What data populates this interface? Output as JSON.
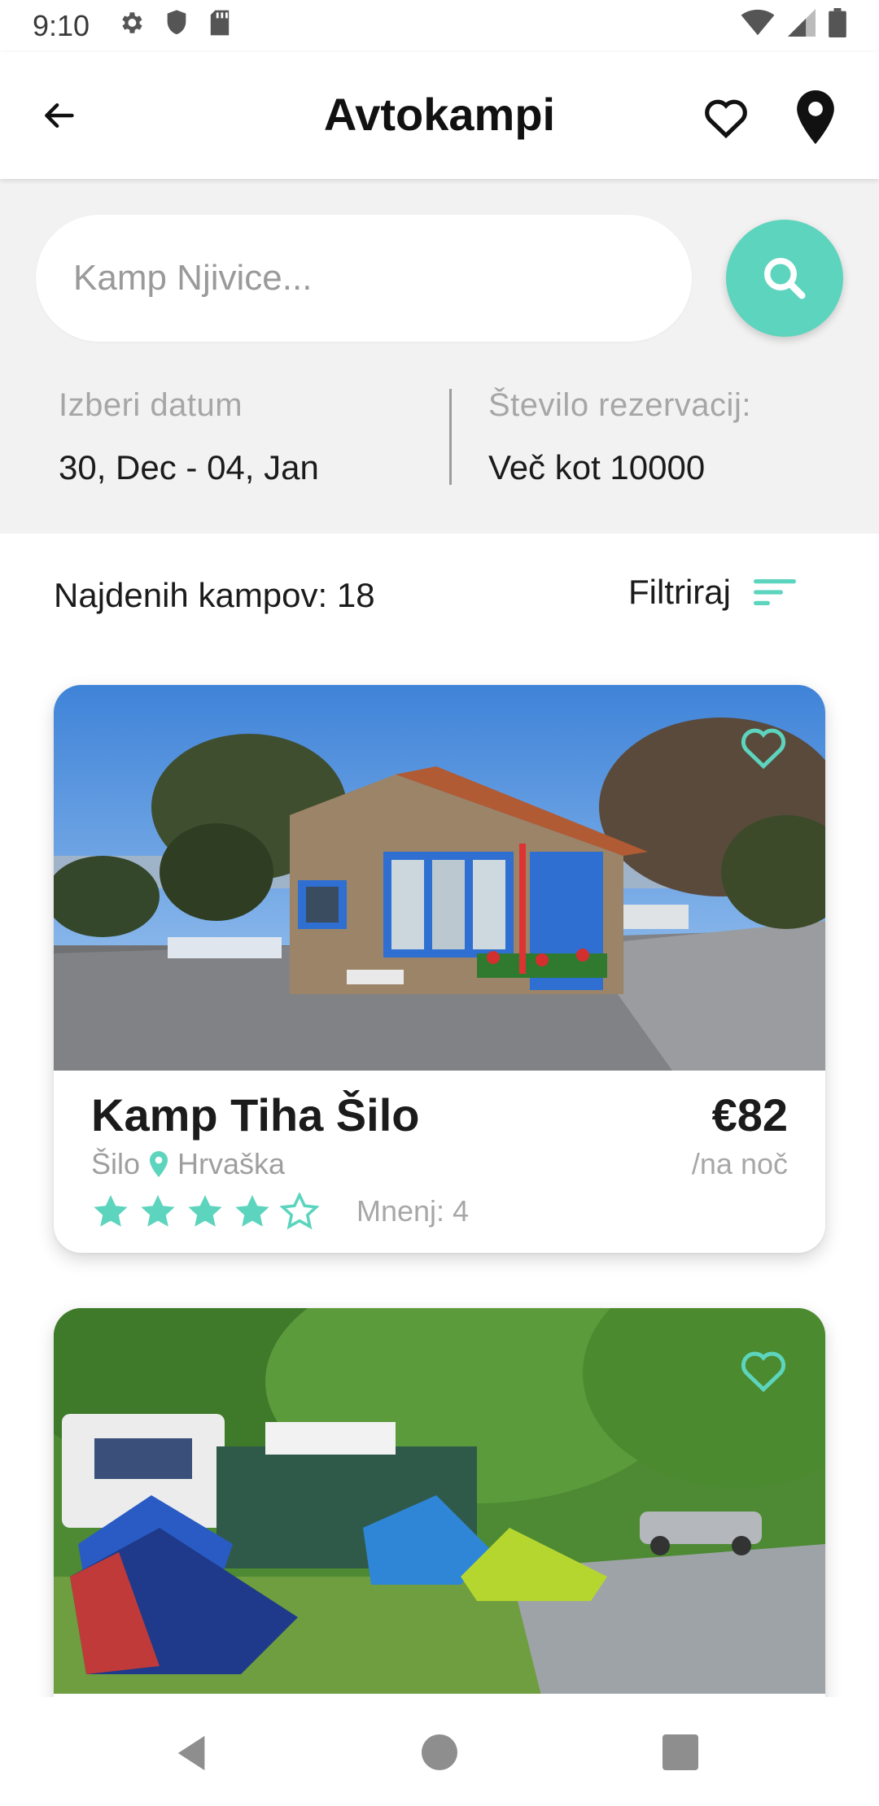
{
  "status_bar": {
    "time": "9:10",
    "icons": [
      "gear-icon",
      "shield-icon",
      "sd-card-icon"
    ],
    "right_icons": [
      "wifi-icon",
      "signal-icon",
      "battery-icon"
    ]
  },
  "app_bar": {
    "title": "Avtokampi",
    "back_icon": "arrow-left-icon",
    "favorites_icon": "heart-outline-icon",
    "map_icon": "location-pin-icon"
  },
  "search": {
    "placeholder": "Kamp Njivice...",
    "value": "",
    "button_icon": "search-icon",
    "accent_color": "#5dd4bd"
  },
  "date": {
    "label": "Izberi datum",
    "value": "30, Dec - 04, Jan"
  },
  "reservations": {
    "label": "Število rezervacij:",
    "value": "Več kot 10000"
  },
  "results": {
    "found_label": "Najdenih kampov: 18",
    "filter_label": "Filtriraj",
    "filter_icon": "filter-lines-icon"
  },
  "camps": [
    {
      "name": "Kamp Tiha Šilo",
      "town": "Šilo",
      "country": "Hrvaška",
      "price": "€82",
      "per_night": "/na noč",
      "rating": 4,
      "max_rating": 5,
      "reviews": "Mnenj: 4",
      "photo_icon": "camp-building-photo"
    },
    {
      "name": "",
      "photo_icon": "camp-tents-photo"
    }
  ],
  "nav_bar": {
    "icons": [
      "nav-back-icon",
      "nav-home-icon",
      "nav-recents-icon"
    ]
  }
}
